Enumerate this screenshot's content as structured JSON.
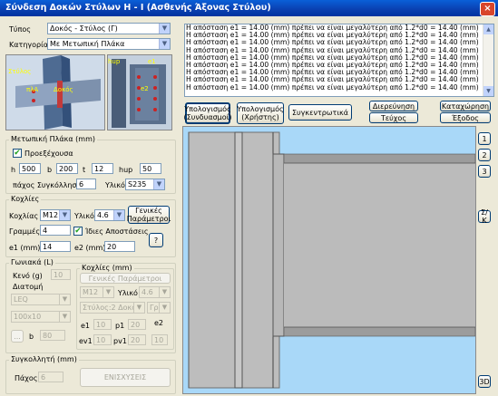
{
  "window": {
    "title": "Σύνδεση Δοκών Στύλων Η - Ι (Ασθενής Άξονας Στύλου)",
    "close_glyph": "×"
  },
  "type": {
    "label": "Τύπος",
    "value": "Δοκός - Στύλος (Γ)"
  },
  "category": {
    "label": "Κατηγορία",
    "value": "Με Μετωπική Πλάκα"
  },
  "preview": {
    "left_labels": [
      "Στύλος",
      "πλΑ",
      "Δοκός"
    ],
    "right_labels": [
      "hup",
      "e1",
      "e2"
    ]
  },
  "end_plate": {
    "group_label": "Μετωπική Πλάκα (mm)",
    "protruding_label": "Προεξέχουσα",
    "h_label": "h",
    "h_value": "500",
    "b_label": "b",
    "b_value": "200",
    "t_label": "t",
    "t_value": "12",
    "hup_label": "hup",
    "hup_value": "50",
    "weld_label": "πάχος Συγκόλλησης",
    "weld_value": "6",
    "material_label": "Υλικό",
    "material_value": "S235"
  },
  "bolts": {
    "group_label": "Κοχλίες",
    "bolt_label": "Κοχλίας",
    "bolt_value": "M12",
    "material_label": "Υλικό",
    "material_value": "4.6",
    "general_params_label": [
      "Γενικές",
      "Παράμετροι"
    ],
    "rows_label": "Γραμμές",
    "rows_value": "4",
    "equal_dist_label": "Ίδιες Αποστάσεις",
    "e1_label": "e1 (mm)",
    "e1_value": "14",
    "e2_label": "e2 (mm)",
    "e2_value": "20",
    "help_label": "?"
  },
  "angle": {
    "group_label": "Γωνιακά (L)",
    "gap_label": "Κενό (g)",
    "gap_value": "10",
    "section_label": "Διατομή",
    "section_value": "LEQ",
    "size_value": "100x10",
    "b_btn_label": "...",
    "b_label": "b",
    "b_value": "80",
    "bolts_group_label": "Κοχλίες (mm)",
    "general_params_label": "Γενικές Παράμετροι",
    "bolt_value": "M12",
    "material_label": "Υλικό",
    "material_value": "4.6",
    "row_config_value": "Στύλος:2 Δοκός:",
    "gr_value": "Γρ.",
    "e1_label": "e1",
    "e1_value": "10",
    "p1_label": "p1",
    "p1_value": "20",
    "e2_label": "e2",
    "ev1_label": "ev1",
    "ev1_value": "10",
    "pv1_label": "pv1",
    "pv1_value": "20",
    "pv1_right": "10"
  },
  "weld": {
    "group_label": "Συγκολλητή (mm)",
    "thickness_label": "Πάχος",
    "thickness_value": "6",
    "reinforce_label": "ΕΝΙΣΧΥΣΕΙΣ"
  },
  "messages": [
    "Η απόσταση e1 = 14.00 (mm) πρέπει να είναι μεγαλύτερη από 1.2*d0 = 14.40 (mm)",
    "Η απόσταση e1 = 14.00 (mm) πρέπει να είναι μεγαλύτερη από 1.2*d0 = 14.40 (mm)",
    "Η απόσταση e1 = 14.00 (mm) πρέπει να είναι μεγαλύτερη από 1.2*d0 = 14.40 (mm)",
    "Η απόσταση e1 = 14.00 (mm) πρέπει να είναι μεγαλύτερη από 1.2*d0 = 14.40 (mm)",
    "Η απόσταση e1 = 14.00 (mm) πρέπει να είναι μεγαλύτερη από 1.2*d0 = 14.40 (mm)",
    "Η απόσταση e1 = 14.00 (mm) πρέπει να είναι μεγαλύτερη από 1.2*d0 = 14.40 (mm)",
    "Η απόσταση e1 = 14.00 (mm) πρέπει να είναι μεγαλύτερη από 1.2*d0 = 14.40 (mm)",
    "Η απόσταση e1 = 14.00 (mm) πρέπει να είναι μεγαλύτερη από 1.2*d0 = 14.40 (mm)",
    "Η απόσταση e1 = 14.00 (mm) πρέπει να είναι μεγαλύτερη από 1.2*d0 = 14.40 (mm)"
  ],
  "actions": {
    "calc_joint": [
      "Υπολογισμός",
      "(Συνδυασμοί)"
    ],
    "calc_user": [
      "Υπολογισμός",
      "(Χρήστης)"
    ],
    "summary": "Συγκεντρωτικά",
    "explore": [
      "Διερεύνηση",
      "Τεύχος"
    ],
    "register": [
      "Καταχώρηση",
      "Έξοδος"
    ]
  },
  "side_buttons": [
    "1",
    "2",
    "3",
    "Σ/Κ"
  ],
  "view_3d_label": "3D"
}
